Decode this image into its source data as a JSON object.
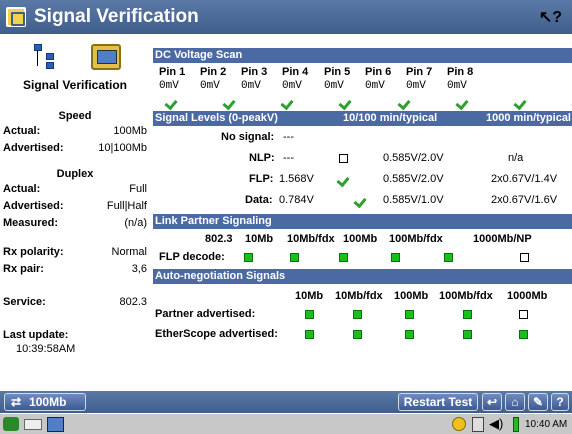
{
  "title": "Signal Verification",
  "help_glyph": "?",
  "left": {
    "heading": "Signal Verification",
    "speed_title": "Speed",
    "speed": [
      {
        "label": "Actual:",
        "value": "100Mb"
      },
      {
        "label": "Advertised:",
        "value": "10|100Mb"
      }
    ],
    "duplex_title": "Duplex",
    "duplex": [
      {
        "label": "Actual:",
        "value": "Full"
      },
      {
        "label": "Advertised:",
        "value": "Full|Half"
      },
      {
        "label": "Measured:",
        "value": "(n/a)"
      }
    ],
    "rx_polarity": {
      "label": "Rx polarity:",
      "value": "Normal"
    },
    "rx_pair": {
      "label": "Rx pair:",
      "value": "3,6"
    },
    "service": {
      "label": "Service:",
      "value": "802.3"
    },
    "last_update": {
      "label": "Last update:",
      "value": "10:39:58AM"
    }
  },
  "dc": {
    "header": "DC Voltage Scan",
    "pins": [
      "Pin 1",
      "Pin 2",
      "Pin 3",
      "Pin 4",
      "Pin 5",
      "Pin 6",
      "Pin 7",
      "Pin 8"
    ],
    "values": [
      "0mV",
      "0mV",
      "0mV",
      "0mV",
      "0mV",
      "0mV",
      "0mV",
      "0mV"
    ]
  },
  "signal": {
    "header": "Signal Levels (0-peakV)",
    "col2": "10/100 min/typical",
    "col3": "1000 min/typical",
    "no_signal": {
      "label": "No signal:",
      "value": "---"
    },
    "nlp": {
      "label": "NLP:",
      "value": "---",
      "range": "0.585V/2.0V",
      "gig": "n/a"
    },
    "flp": {
      "label": "FLP:",
      "value": "1.568V",
      "range": "0.585V/2.0V",
      "gig": "2x0.67V/1.4V"
    },
    "data": {
      "label": "Data:",
      "value": "0.784V",
      "range": "0.585V/1.0V",
      "gig": "2x0.67V/1.6V"
    }
  },
  "lps": {
    "header": "Link Partner Signaling",
    "cols": [
      "802.3",
      "10Mb",
      "10Mb/fdx",
      "100Mb",
      "100Mb/fdx",
      "1000Mb/NP"
    ],
    "row_label": "FLP decode:"
  },
  "ans": {
    "header": "Auto-negotiation Signals",
    "cols": [
      "10Mb",
      "10Mb/fdx",
      "100Mb",
      "100Mb/fdx",
      "1000Mb"
    ],
    "rows": [
      "Partner advertised:",
      "EtherScope advertised:"
    ]
  },
  "bottom": {
    "speed_btn": "100Mb",
    "restart_btn": "Restart Test",
    "help_btn": "?"
  },
  "taskbar": {
    "time": "10:40 AM"
  }
}
